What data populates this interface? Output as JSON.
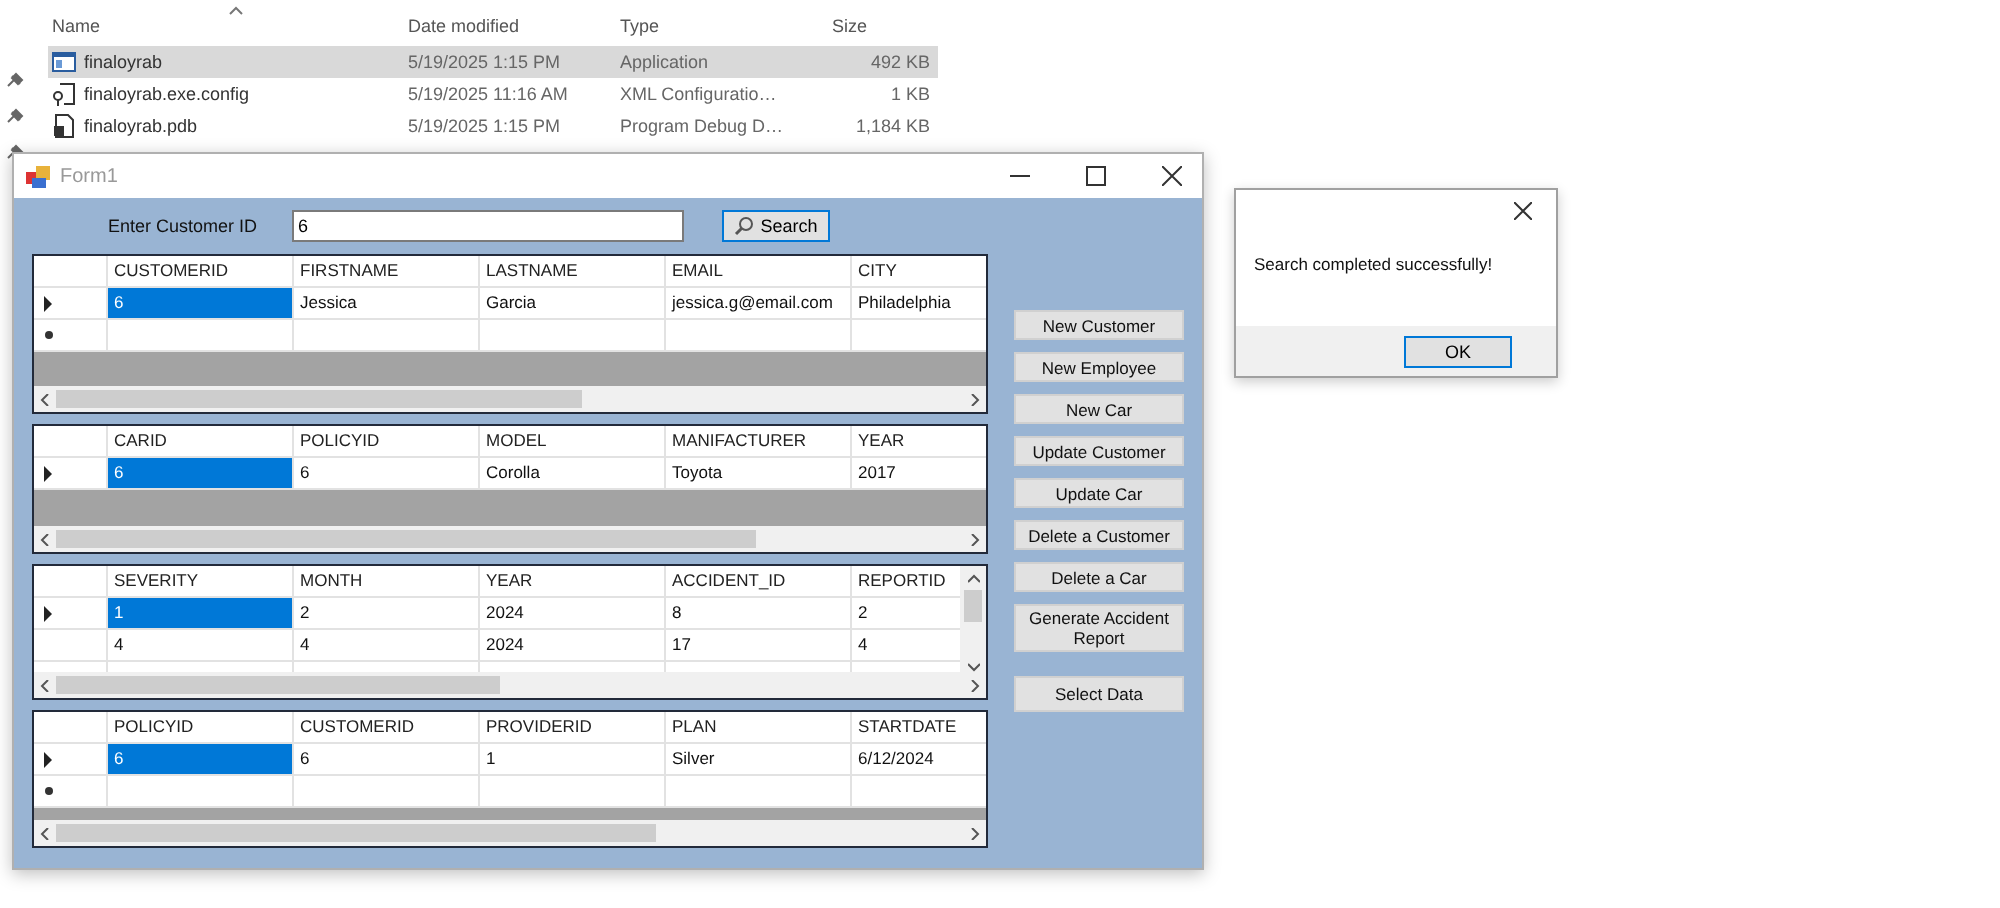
{
  "explorer": {
    "columns": [
      {
        "label": "Name",
        "sorted": true
      },
      {
        "label": "Date modified",
        "sorted": false
      },
      {
        "label": "Type",
        "sorted": false
      },
      {
        "label": "Size",
        "sorted": false
      }
    ],
    "files": [
      {
        "name": "finaloyrab",
        "date": "5/19/2025 1:15 PM",
        "type": "Application",
        "size": "492 KB",
        "kind": "app",
        "selected": true
      },
      {
        "name": "finaloyrab.exe.config",
        "date": "5/19/2025 11:16 AM",
        "type": "XML Configuratio…",
        "size": "1 KB",
        "kind": "config",
        "selected": false
      },
      {
        "name": "finaloyrab.pdb",
        "date": "5/19/2025 1:15 PM",
        "type": "Program Debug D…",
        "size": "1,184 KB",
        "kind": "pdb",
        "selected": false
      }
    ]
  },
  "form": {
    "title": "Form1",
    "search": {
      "label": "Enter Customer ID",
      "value": "6",
      "button": "Search"
    },
    "grids": [
      {
        "columns": [
          "CUSTOMERID",
          "FIRSTNAME",
          "LASTNAME",
          "EMAIL",
          "CITY"
        ],
        "vertical_scrollbar": false,
        "rows": [
          {
            "kind": "current",
            "cells": [
              {
                "text": "6",
                "selected": true
              },
              {
                "text": "Jessica",
                "selected": false
              },
              {
                "text": "Garcia",
                "selected": false
              },
              {
                "text": "jessica.g@email.com",
                "selected": false
              },
              {
                "text": "Philadelphia",
                "selected": false
              }
            ]
          },
          {
            "kind": "new"
          }
        ]
      },
      {
        "columns": [
          "CARID",
          "POLICYID",
          "MODEL",
          "MANIFACTURER",
          "YEAR"
        ],
        "vertical_scrollbar": false,
        "rows": [
          {
            "kind": "current",
            "cells": [
              {
                "text": "6",
                "selected": true
              },
              {
                "text": "6",
                "selected": false
              },
              {
                "text": "Corolla",
                "selected": false
              },
              {
                "text": "Toyota",
                "selected": false
              },
              {
                "text": "2017",
                "selected": false
              }
            ]
          }
        ]
      },
      {
        "columns": [
          "SEVERITY",
          "MONTH",
          "YEAR",
          "ACCIDENT_ID",
          "REPORTID"
        ],
        "vertical_scrollbar": true,
        "rows": [
          {
            "kind": "current",
            "cells": [
              {
                "text": "1",
                "selected": true
              },
              {
                "text": "2",
                "selected": false
              },
              {
                "text": "2024",
                "selected": false
              },
              {
                "text": "8",
                "selected": false
              },
              {
                "text": "2",
                "selected": false
              }
            ]
          },
          {
            "kind": "normal",
            "cells": [
              {
                "text": "4",
                "selected": false
              },
              {
                "text": "4",
                "selected": false
              },
              {
                "text": "2024",
                "selected": false
              },
              {
                "text": "17",
                "selected": false
              },
              {
                "text": "4",
                "selected": false
              }
            ]
          },
          {
            "kind": "blank"
          }
        ]
      },
      {
        "columns": [
          "POLICYID",
          "CUSTOMERID",
          "PROVIDERID",
          "PLAN",
          "STARTDATE"
        ],
        "vertical_scrollbar": false,
        "rows": [
          {
            "kind": "current",
            "cells": [
              {
                "text": "6",
                "selected": true
              },
              {
                "text": "6",
                "selected": false
              },
              {
                "text": "1",
                "selected": false
              },
              {
                "text": "Silver",
                "selected": false
              },
              {
                "text": "6/12/2024",
                "selected": false
              }
            ]
          },
          {
            "kind": "new"
          }
        ]
      }
    ],
    "buttons": [
      "New Customer",
      "New Employee",
      "New Car",
      "Update Customer",
      "Update Car",
      "Delete a Customer",
      "Delete a Car",
      "Generate Accident Report",
      "Select Data"
    ]
  },
  "dialog": {
    "message": "Search completed successfully!",
    "button": "OK"
  }
}
